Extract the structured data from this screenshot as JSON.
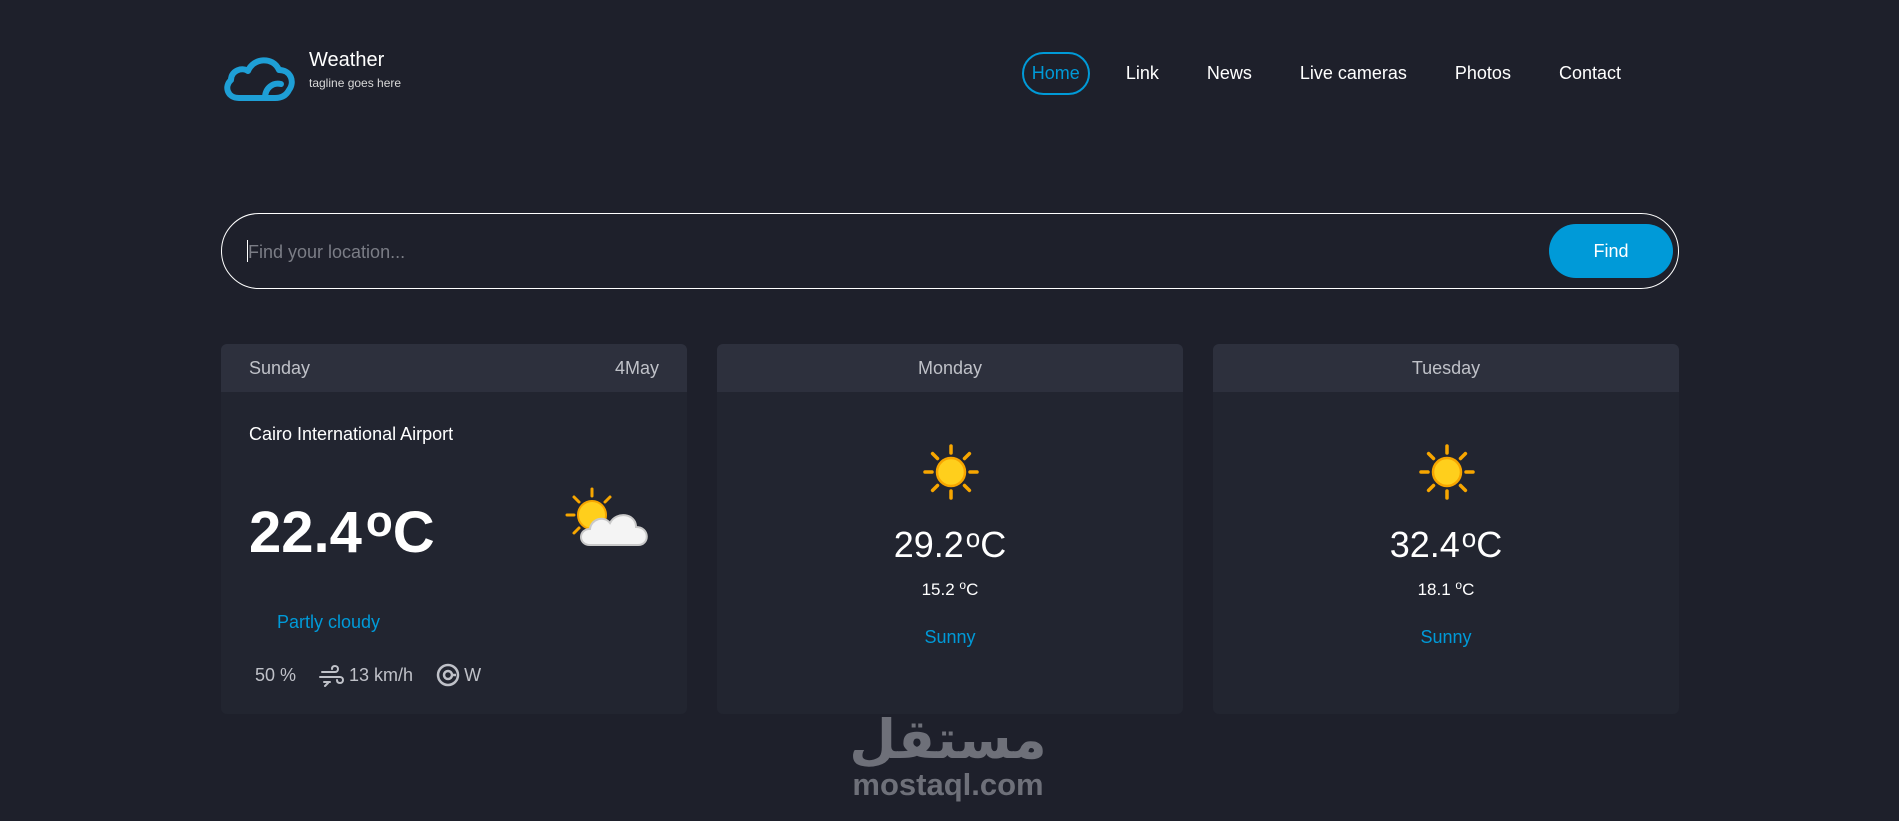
{
  "brand": {
    "title": "Weather",
    "tagline": "tagline goes here",
    "logo_icon": "cloud-icon",
    "accent": "#009ad8"
  },
  "nav": {
    "items": [
      {
        "label": "Home",
        "active": true
      },
      {
        "label": "Link"
      },
      {
        "label": "News"
      },
      {
        "label": "Live cameras"
      },
      {
        "label": "Photos"
      },
      {
        "label": "Contact"
      }
    ]
  },
  "search": {
    "placeholder": "Find your location...",
    "value": "",
    "button_label": "Find"
  },
  "today": {
    "day": "Sunday",
    "date": "4May",
    "location": "Cairo International Airport",
    "temp": "22.4",
    "unit_deg": "o",
    "unit_c": "C",
    "icon": "partly-cloudy-icon",
    "condition": "Partly cloudy",
    "humidity": "50 %",
    "wind": "13 km/h",
    "direction": "W"
  },
  "forecast": [
    {
      "day": "Monday",
      "max": "29.2",
      "min": "15.2",
      "condition": "Sunny",
      "icon": "sun-icon"
    },
    {
      "day": "Tuesday",
      "max": "32.4",
      "min": "18.1",
      "condition": "Sunny",
      "icon": "sun-icon"
    }
  ],
  "watermark": {
    "arabic": "مستقل",
    "latin": "mostaql.com"
  },
  "colors": {
    "background": "#1e202b",
    "card": "#222530",
    "card_header": "#2d303d",
    "accent": "#009ad8"
  }
}
